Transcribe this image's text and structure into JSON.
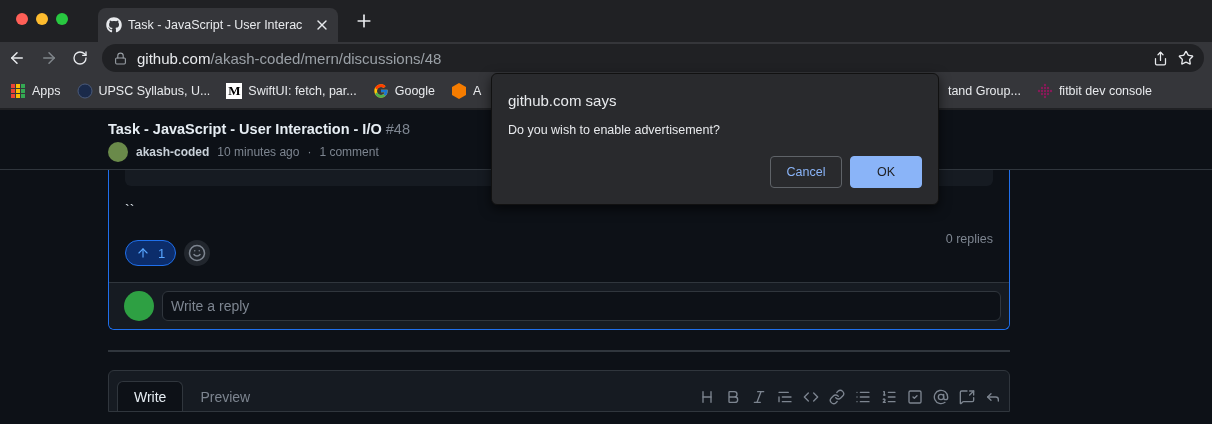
{
  "browser": {
    "tabs": [
      {
        "title": "Task - JavaScript - User Interac",
        "selected": true
      }
    ],
    "address": {
      "domain": "github.com",
      "path": "/akash-coded/mern/discussions/48"
    },
    "bookmarks_left": [
      {
        "kind": "apps",
        "label": "Apps"
      },
      {
        "kind": "emblem",
        "label": "UPSC Syllabus, U..."
      },
      {
        "kind": "letter",
        "label": "SwiftUI: fetch, par...",
        "letter": "M"
      },
      {
        "kind": "google",
        "label": "Google"
      },
      {
        "kind": "cube",
        "label": "A"
      }
    ],
    "bookmarks_right": [
      {
        "kind": "none",
        "label": "tand Group..."
      },
      {
        "kind": "dots",
        "label": "fitbit dev console"
      }
    ]
  },
  "discussion": {
    "title": "Task - JavaScript - User Interaction - I/O",
    "number": "#48",
    "author": "akash-coded",
    "time": "10 minutes ago",
    "separator": "·",
    "comments": "1 comment",
    "body_text": "``",
    "upvote": {
      "count": "1",
      "selected": true
    },
    "replies": "0 replies",
    "reply_placeholder": "Write a reply"
  },
  "editor": {
    "tabs": [
      {
        "label": "Write",
        "selected": true
      },
      {
        "label": "Preview",
        "selected": false
      }
    ]
  },
  "dialog": {
    "title": "github.com says",
    "message": "Do you wish to enable advertisement?",
    "buttons": [
      {
        "label": "Cancel",
        "kind": "secondary"
      },
      {
        "label": "OK",
        "kind": "primary"
      }
    ]
  }
}
